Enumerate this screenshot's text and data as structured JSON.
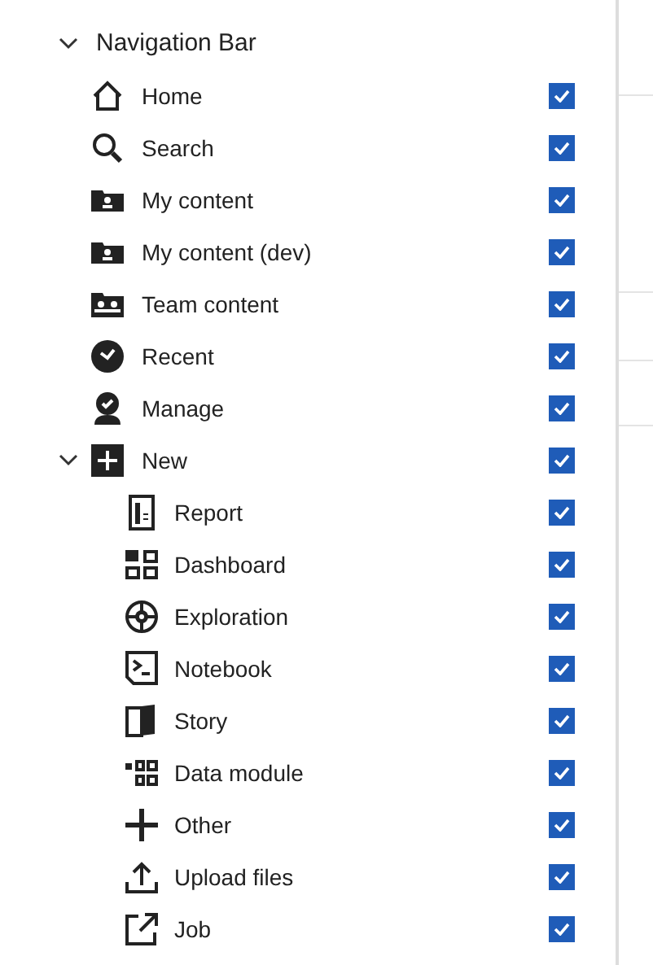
{
  "navigation_bar": {
    "label": "Navigation Bar",
    "expanded": true,
    "children": [
      {
        "label": "Home",
        "checked": true
      },
      {
        "label": "Search",
        "checked": true
      },
      {
        "label": "My content",
        "checked": true
      },
      {
        "label": "My content (dev)",
        "checked": true
      },
      {
        "label": "Team content",
        "checked": true
      },
      {
        "label": "Recent",
        "checked": true
      },
      {
        "label": "Manage",
        "checked": true
      },
      {
        "label": "New",
        "checked": true,
        "expanded": true,
        "children": [
          {
            "label": "Report",
            "checked": true
          },
          {
            "label": "Dashboard",
            "checked": true
          },
          {
            "label": "Exploration",
            "checked": true
          },
          {
            "label": "Notebook",
            "checked": true
          },
          {
            "label": "Story",
            "checked": true
          },
          {
            "label": "Data module",
            "checked": true
          },
          {
            "label": "Other",
            "checked": true
          },
          {
            "label": "Upload files",
            "checked": true
          },
          {
            "label": "Job",
            "checked": true
          }
        ]
      }
    ]
  }
}
